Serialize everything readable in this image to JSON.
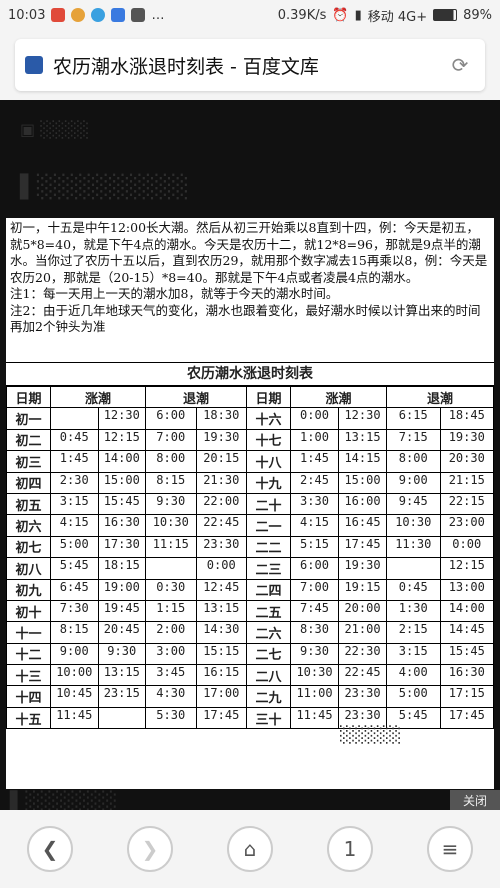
{
  "status": {
    "time": "10:03",
    "speed": "0.39K/s",
    "carrier": "移动 4G+",
    "battery": "89%"
  },
  "browser": {
    "title": "农历潮水涨退时刻表 - 百度文库"
  },
  "doc": {
    "intro": [
      "初一，十五是中午12:00长大潮。然后从初三开始乘以8直到十四，例：今天是初五，就5*8=40，就是下午4点的潮水。今天是农历十二，就12*8=96，那就是9点半的潮水。当你过了农历十五以后，直到农历29，就用那个数字减去15再乘以8，例：今天是农历20，那就是（20-15）*8=40。那就是下午4点或者凌晨4点的潮水。",
      "注1：每一天用上一天的潮水加8，就等于今天的潮水时间。",
      "注2：由于近几年地球天气的变化，潮水也跟着变化，最好潮水时候以计算出来的时间再加2个钟头为准"
    ],
    "table_title": "农历潮水涨退时刻表",
    "headers": [
      "日期",
      "涨潮",
      "退潮",
      "日期",
      "涨潮",
      "退潮"
    ],
    "rows": [
      [
        "初一",
        "",
        "12:30",
        "6:00",
        "18:30",
        "十六",
        "0:00",
        "12:30",
        "6:15",
        "18:45"
      ],
      [
        "初二",
        "0:45",
        "12:15",
        "7:00",
        "19:30",
        "十七",
        "1:00",
        "13:15",
        "7:15",
        "19:30"
      ],
      [
        "初三",
        "1:45",
        "14:00",
        "8:00",
        "20:15",
        "十八",
        "1:45",
        "14:15",
        "8:00",
        "20:30"
      ],
      [
        "初四",
        "2:30",
        "15:00",
        "8:15",
        "21:30",
        "十九",
        "2:45",
        "15:00",
        "9:00",
        "21:15"
      ],
      [
        "初五",
        "3:15",
        "15:45",
        "9:30",
        "22:00",
        "二十",
        "3:30",
        "16:00",
        "9:45",
        "22:15"
      ],
      [
        "初六",
        "4:15",
        "16:30",
        "10:30",
        "22:45",
        "二一",
        "4:15",
        "16:45",
        "10:30",
        "23:00"
      ],
      [
        "初七",
        "5:00",
        "17:30",
        "11:15",
        "23:30",
        "二二",
        "5:15",
        "17:45",
        "11:30",
        "0:00"
      ],
      [
        "初八",
        "5:45",
        "18:15",
        "",
        "0:00",
        "二三",
        "6:00",
        "19:30",
        "",
        "12:15"
      ],
      [
        "初九",
        "6:45",
        "19:00",
        "0:30",
        "12:45",
        "二四",
        "7:00",
        "19:15",
        "0:45",
        "13:00"
      ],
      [
        "初十",
        "7:30",
        "19:45",
        "1:15",
        "13:15",
        "二五",
        "7:45",
        "20:00",
        "1:30",
        "14:00"
      ],
      [
        "十一",
        "8:15",
        "20:45",
        "2:00",
        "14:30",
        "二六",
        "8:30",
        "21:00",
        "2:15",
        "14:45"
      ],
      [
        "十二",
        "9:00",
        "9:30",
        "3:00",
        "15:15",
        "二七",
        "9:30",
        "22:30",
        "3:15",
        "15:45"
      ],
      [
        "十三",
        "10:00",
        "13:15",
        "3:45",
        "16:15",
        "二八",
        "10:30",
        "22:45",
        "4:00",
        "16:30"
      ],
      [
        "十四",
        "10:45",
        "23:15",
        "4:30",
        "17:00",
        "二九",
        "11:00",
        "23:30",
        "5:00",
        "17:15"
      ],
      [
        "十五",
        "11:45",
        "",
        "5:30",
        "17:45",
        "三十",
        "11:45",
        "23:30",
        "5:45",
        "17:45"
      ]
    ]
  },
  "overlay": {
    "close": "关闭"
  },
  "nav": {
    "page_num": "1"
  }
}
